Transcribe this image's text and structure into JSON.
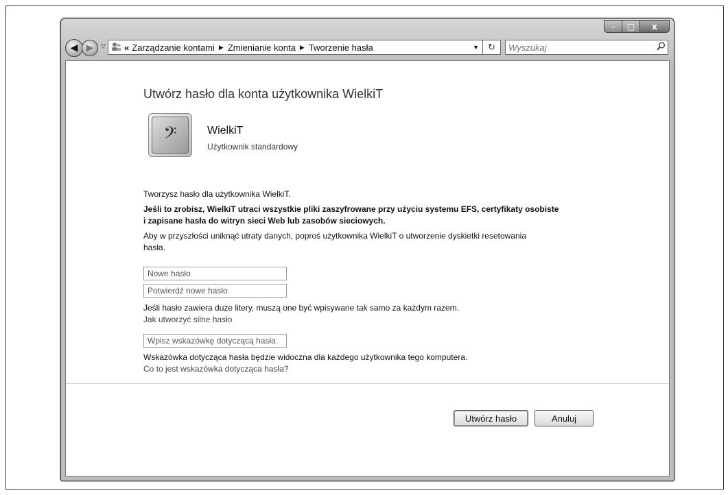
{
  "window": {
    "min_label": "–",
    "max_label": "□",
    "close_label": "x"
  },
  "nav": {
    "back_glyph": "◀",
    "forward_glyph": "▶",
    "dropdown_glyph": "▽"
  },
  "address": {
    "chevron": "«",
    "crumbs": [
      "Zarządzanie kontami",
      "Zmienianie konta",
      "Tworzenie hasła"
    ],
    "separator": "▶",
    "dropdown_glyph": "▼"
  },
  "refresh_glyph": "↻",
  "search": {
    "placeholder": "Wyszukaj",
    "icon": "search-icon"
  },
  "page": {
    "title": "Utwórz hasło dla konta użytkownika WielkiT",
    "user": {
      "name": "WielkiT",
      "type": "Użytkownik standardowy",
      "avatar_glyph": "𝄢"
    },
    "intro": "Tworzysz hasło dla użytkownika WielkiT.",
    "warning_line1": "Jeśli to zrobisz, WielkiT utraci wszystkie pliki zaszyfrowane przy użyciu systemu EFS, certyfikaty osobiste",
    "warning_line2": "i zapisane hasła do witryn sieci Web lub zasobów sieciowych.",
    "advice_line1": "Aby w przyszłości uniknąć utraty danych, poproś użytkownika WielkiT o utworzenie dyskietki resetowania",
    "advice_line2": "hasła.",
    "new_password_placeholder": "Nowe hasło",
    "confirm_password_placeholder": "Potwierdź nowe hasło",
    "caps_note": "Jeśli hasło zawiera duże litery, muszą one być wpisywane tak samo za każdym razem.",
    "strong_link": "Jak utworzyć silne hasło",
    "hint_placeholder": "Wpisz wskazówkę dotyczącą hasła",
    "hint_note": "Wskazówka dotycząca hasła będzie widoczna dla każdego użytkownika tego komputera.",
    "hint_link": "Co to jest wskazówka dotycząca hasła?"
  },
  "buttons": {
    "create": "Utwórz hasło",
    "cancel": "Anuluj"
  }
}
